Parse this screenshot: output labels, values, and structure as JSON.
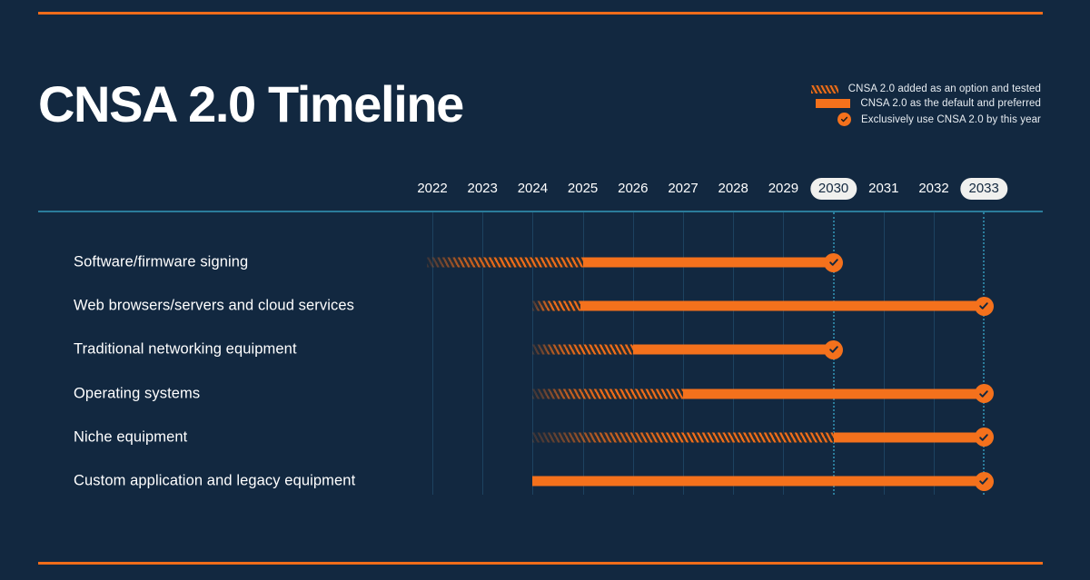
{
  "title": "CNSA 2.0 Timeline",
  "colors": {
    "background": "#122840",
    "accent": "#f4711c",
    "rule": "#ef6c1a",
    "grid": "#1d4260",
    "axis": "#2b7c9b",
    "text": "#ffffff",
    "highlight_pill": "#f0f0ee"
  },
  "legend": {
    "items": [
      {
        "icon": "hatched-bar-swatch",
        "label": "CNSA 2.0 added as an option and tested"
      },
      {
        "icon": "solid-bar-swatch",
        "label": "CNSA 2.0 as the default and preferred"
      },
      {
        "icon": "check-circle-icon",
        "label": "Exclusively use CNSA 2.0 by this year"
      }
    ]
  },
  "chart_data": {
    "type": "bar",
    "title": "CNSA 2.0 Timeline",
    "xlabel": "",
    "ylabel": "",
    "grid": true,
    "legend_position": "top-right",
    "categories": [
      "Software/firmware signing",
      "Web browsers/servers and cloud services",
      "Traditional networking equipment",
      "Operating systems",
      "Niche equipment",
      "Custom application and legacy equipment"
    ],
    "x_ticks": [
      "2022",
      "2023",
      "2024",
      "2025",
      "2026",
      "2027",
      "2028",
      "2029",
      "2030",
      "2031",
      "2032",
      "2033"
    ],
    "highlighted_ticks": [
      "2030",
      "2033"
    ],
    "xlim": [
      2022,
      2033
    ],
    "series": [
      {
        "name": "Software/firmware signing",
        "tested_start": 2021.9,
        "tested_end": 2025.0,
        "default_start": 2025.0,
        "deadline": 2030
      },
      {
        "name": "Web browsers/servers and cloud services",
        "tested_start": 2024.0,
        "tested_end": 2024.95,
        "default_start": 2024.95,
        "deadline": 2033
      },
      {
        "name": "Traditional networking equipment",
        "tested_start": 2024.0,
        "tested_end": 2026.0,
        "default_start": 2026.0,
        "deadline": 2030
      },
      {
        "name": "Operating systems",
        "tested_start": 2024.0,
        "tested_end": 2027.0,
        "default_start": 2027.0,
        "deadline": 2033
      },
      {
        "name": "Niche equipment",
        "tested_start": 2024.0,
        "tested_end": 2030.0,
        "default_start": 2030.0,
        "deadline": 2033
      },
      {
        "name": "Custom application and legacy equipment",
        "tested_start": null,
        "tested_end": null,
        "default_start": 2024.0,
        "deadline": 2033
      }
    ]
  }
}
